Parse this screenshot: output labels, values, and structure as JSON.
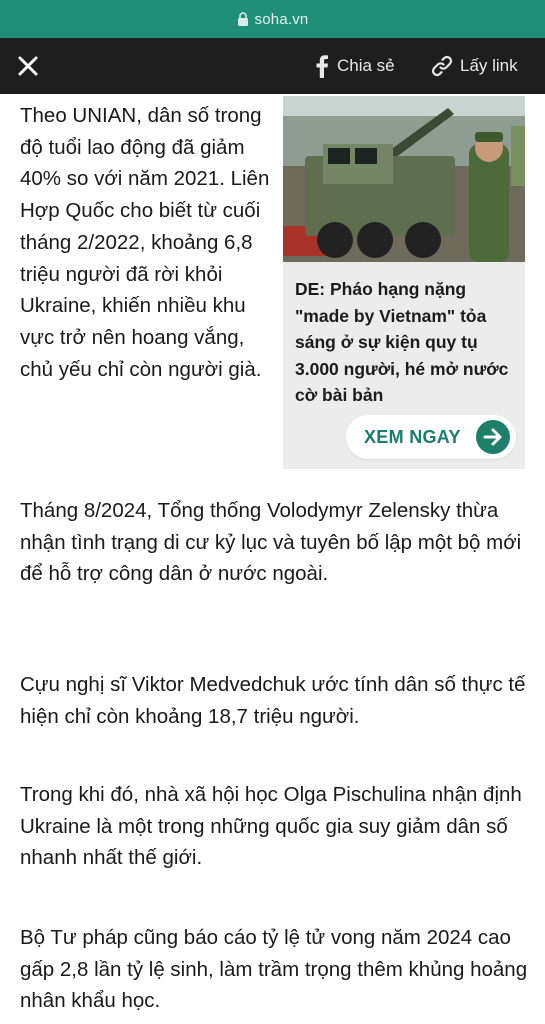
{
  "browser": {
    "url": "soha.vn",
    "lock_icon": "lock-icon"
  },
  "toolbar": {
    "close_icon": "close-icon",
    "share_label": "Chia sẻ",
    "share_icon": "facebook-icon",
    "link_label": "Lấy link",
    "link_icon": "link-icon"
  },
  "article": {
    "paragraphs": [
      "Theo UNIAN, dân số trong độ tuổi lao động đã giảm 40% so với năm 2021. Liên Hợp Quốc cho biết từ cuối tháng 2/2022, khoảng 6,8 triệu người đã rời khỏi Ukraine, khiến nhiều khu vực trở nên hoang vắng, chủ yếu chỉ còn người già.",
      "Tháng 8/2024, Tổng thống Volodymyr Zelensky thừa nhận tình trạng di cư kỷ lục và tuyên bố lập một bộ mới để hỗ trợ công dân ở nước ngoài.",
      "Cựu nghị sĩ Viktor Medvedchuk ước tính dân số thực tế hiện chỉ còn khoảng 18,7 triệu người.",
      "Trong khi đó, nhà xã hội học Olga Pischulina nhận định Ukraine là một trong những quốc gia suy giảm dân số nhanh nhất thế giới.",
      "Bộ Tư pháp cũng báo cáo tỷ lệ tử vong năm 2024 cao gấp 2,8 lần tỷ lệ sinh, làm trầm trọng thêm khủng hoảng nhân khẩu học."
    ]
  },
  "related": {
    "title": "DE: Pháo hạng nặng \"made by Vietnam\" tỏa sáng ở sự kiện quy tụ 3.000 người, hé mở nước cờ bài bản",
    "button_label": "XEM NGAY",
    "button_icon": "arrow-right-icon"
  },
  "colors": {
    "url_bar": "#1f8f77",
    "toolbar": "#1e1e1e",
    "accent": "#1a7e6b",
    "card_bg": "#ececec"
  }
}
